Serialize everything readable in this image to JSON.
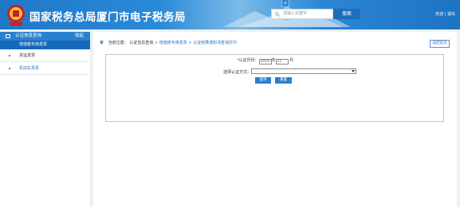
{
  "header": {
    "title": "国家税务总局厦门市电子税务局",
    "search_placeholder": "请输入关键字",
    "search_button": "搜索",
    "tab_marker": "★",
    "right_links": "欢迎 | 退出"
  },
  "sidebar": {
    "section_title": "认证信息查询",
    "section_action": "收起",
    "active_item": "增值税专用发票",
    "items": [
      {
        "label": "货运发票"
      },
      {
        "label": "机动车发票"
      }
    ]
  },
  "main": {
    "breadcrumb_prefix": "当前位置：",
    "breadcrumb_home": "认证信息查询",
    "breadcrumb_sep1": " > ",
    "breadcrumb_mid": "增值税专用发票",
    "breadcrumb_sep2": " > ",
    "breadcrumb_last": "认证结果通知书查询打印",
    "back_button": "返回首页",
    "form": {
      "required_mark": "*",
      "period_label": "认证月份：",
      "year_value": "2019",
      "year_unit": "年",
      "month_value": "11",
      "month_unit": "月",
      "method_label": "选择认证方式：",
      "method_value": "",
      "query_button": "查询",
      "reset_button": "重置"
    }
  },
  "colors": {
    "header_blue": "#2b8ad8",
    "sidebar_active": "#1568b8",
    "button_blue": "#2a80cf",
    "link_blue": "#2a72c2"
  }
}
